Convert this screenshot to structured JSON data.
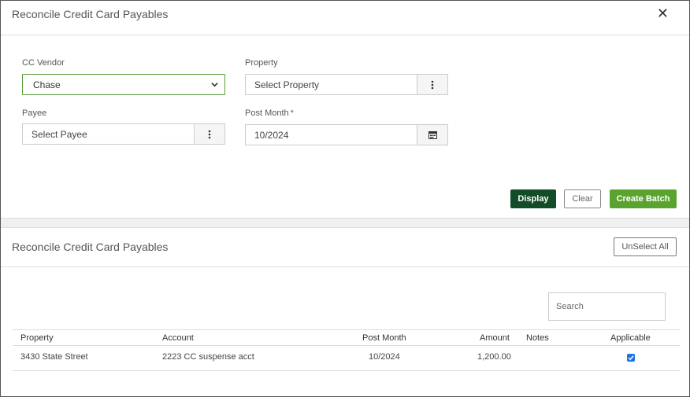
{
  "header": {
    "title": "Reconcile Credit Card Payables",
    "close_glyph": "✕"
  },
  "form": {
    "cc_vendor": {
      "label": "CC Vendor",
      "value": "Chase"
    },
    "property": {
      "label": "Property",
      "value": "Select Property"
    },
    "payee": {
      "label": "Payee",
      "value": "Select Payee"
    },
    "post_month": {
      "label": "Post Month",
      "required_mark": "*",
      "value": "10/2024"
    }
  },
  "actions": {
    "display": "Display",
    "clear": "Clear",
    "create_batch": "Create Batch"
  },
  "results": {
    "title": "Reconcile Credit Card Payables",
    "unselect_all": "UnSelect All",
    "search_placeholder": "Search",
    "columns": [
      "Property",
      "Account",
      "Post Month",
      "Amount",
      "Notes",
      "Applicable"
    ],
    "rows": [
      {
        "property": "3430 State Street",
        "account": "2223 CC suspense acct",
        "post_month": "10/2024",
        "amount": "1,200.00",
        "notes": "",
        "applicable": true
      }
    ]
  },
  "colors": {
    "primary_dark": "#124d27",
    "primary": "#5ba32f",
    "required": "#c0392b",
    "checkbox": "#1a73e8"
  }
}
